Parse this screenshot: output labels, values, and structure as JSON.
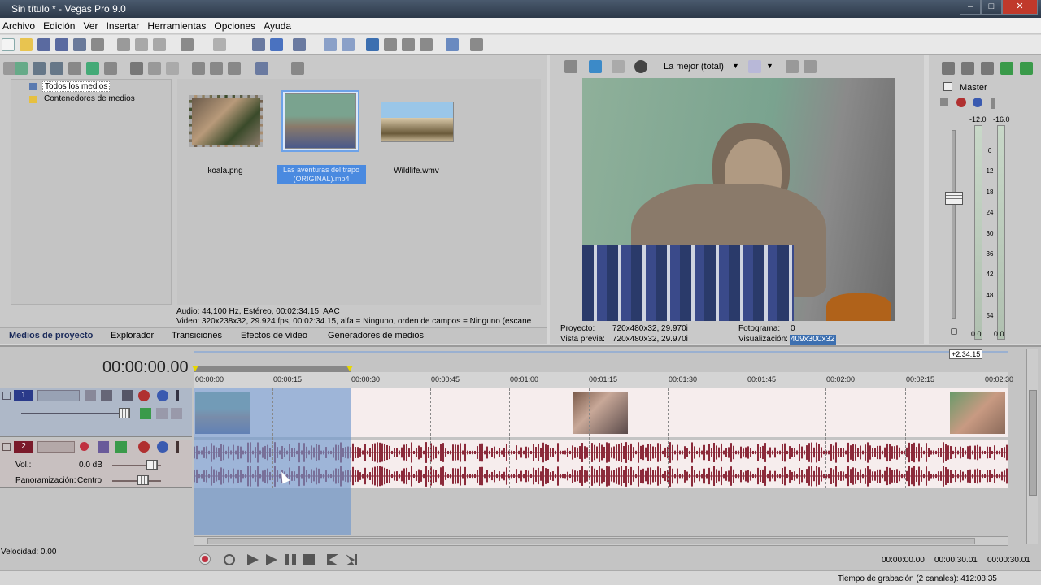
{
  "window": {
    "title": "Sin título * - Vegas Pro 9.0",
    "minimize": "–",
    "maximize": "□",
    "close": "✕"
  },
  "menu": [
    "Archivo",
    "Edición",
    "Ver",
    "Insertar",
    "Herramientas",
    "Opciones",
    "Ayuda"
  ],
  "tree": {
    "items": [
      "Todos los medios",
      "Contenedores de medios"
    ]
  },
  "media": [
    {
      "label": "koala.png"
    },
    {
      "label": "Las aventuras del trapo (ORIGINAL).mp4"
    },
    {
      "label": "Wildlife.wmv"
    }
  ],
  "media_info": {
    "audio": "Audio: 44,100 Hz, Estéreo, 00:02:34.15, AAC",
    "video": "Video: 320x238x32, 29.924 fps, 00:02:34.15, alfa = Ninguno, orden de campos = Ninguno (escane"
  },
  "tabs": [
    "Medios de proyecto",
    "Explorador",
    "Transiciones",
    "Efectos de vídeo",
    "Generadores de medios"
  ],
  "preview": {
    "quality": "La mejor (total)",
    "proyecto_label": "Proyecto:",
    "proyecto_value": "720x480x32, 29.970i",
    "vista_label": "Vista previa:",
    "vista_value": "720x480x32, 29.970i",
    "fotograma_label": "Fotograma:",
    "fotograma_value": "0",
    "visual_label": "Visualización:",
    "visual_value": "409x300x32"
  },
  "mixer": {
    "title": "Master",
    "peak_left": "-12.0",
    "peak_right": "-16.0",
    "scale": [
      "6",
      "12",
      "18",
      "24",
      "30",
      "36",
      "42",
      "48",
      "54"
    ],
    "bottom_left": "0.0",
    "bottom_right": "0.0"
  },
  "timeline": {
    "timecode": "00:00:00.00",
    "end_marker": "+2:34.15",
    "ruler": [
      "00:00:00",
      "00:00:15",
      "00:00:30",
      "00:00:45",
      "00:01:00",
      "00:01:15",
      "00:01:30",
      "00:01:45",
      "00:02:00",
      "00:02:15",
      "00:02:30"
    ],
    "track1_number": "1",
    "track2_number": "2",
    "vol_label": "Vol.:",
    "vol_value": "0.0 dB",
    "pan_label": "Panoramización:",
    "pan_value": "Centro"
  },
  "transport": {
    "speed_label": "Velocidad: 0.00",
    "time_start": "00:00:00.00",
    "time_end": "00:00:30.01",
    "time_length": "00:00:30.01"
  },
  "status": {
    "text": "Tiempo de grabación (2 canales): 412:08:35"
  },
  "colors": {
    "accent": "#3c6fb0",
    "waveform": "#8b2a3a",
    "selection": "#6e96cd"
  }
}
